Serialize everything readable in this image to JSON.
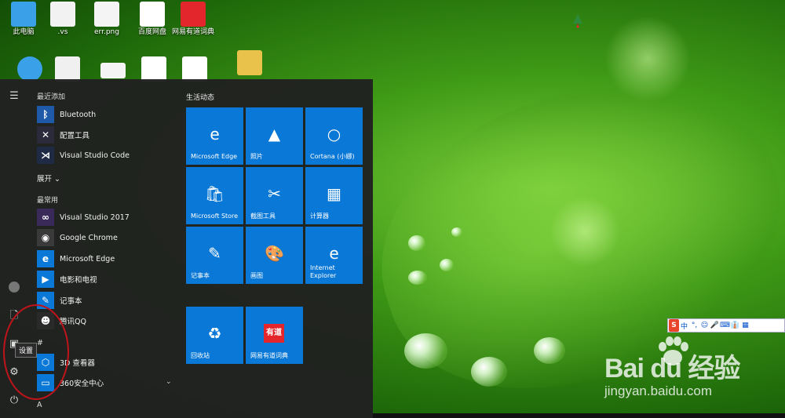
{
  "desktop": {
    "icons": [
      {
        "label": "此电脑",
        "color": "#3aa0e8"
      },
      {
        "label": ".vs",
        "color": "#f2f2f2"
      },
      {
        "label": "err.png",
        "color": "#f4f4f4"
      },
      {
        "label": "百度网盘",
        "color": "#ffffff"
      },
      {
        "label": "网易有道词典",
        "color": "#e3262b"
      }
    ],
    "tree_icon": "christmas-tree-icon"
  },
  "start_menu": {
    "recent_header": "最近添加",
    "recent": [
      {
        "label": "Bluetooth",
        "icon": "bluetooth-icon",
        "color": "#1f5aa8"
      },
      {
        "label": "配置工具",
        "icon": "tools-icon",
        "color": "#2a2a3a"
      },
      {
        "label": "Visual Studio Code",
        "icon": "vscode-icon",
        "color": "#1f2a44"
      }
    ],
    "expand_label": "展开",
    "frequent_header": "最常用",
    "frequent": [
      {
        "label": "Visual Studio 2017",
        "icon": "visual-studio-icon",
        "color": "#3a2a5a"
      },
      {
        "label": "Google Chrome",
        "icon": "chrome-icon",
        "color": "#3a3a3a"
      },
      {
        "label": "Microsoft Edge",
        "icon": "edge-icon",
        "color": "#0a78d6"
      },
      {
        "label": "电影和电视",
        "icon": "film-icon",
        "color": "#0a78d6"
      },
      {
        "label": "记事本",
        "icon": "notepad-icon",
        "color": "#0a78d6"
      },
      {
        "label": "腾讯QQ",
        "icon": "qq-icon",
        "color": "#2a2a2a"
      }
    ],
    "section_hash": "#",
    "alpha": [
      {
        "label": "3D 查看器",
        "icon": "cube-icon",
        "color": "#0a78d6"
      },
      {
        "label": "360安全中心",
        "icon": "folder-icon",
        "color": "#0a78d6"
      }
    ],
    "letter_a": "A",
    "tile_group_title": "生活动态",
    "tiles": [
      {
        "label": "Microsoft Edge",
        "icon": "edge-icon",
        "glyph": "e"
      },
      {
        "label": "照片",
        "icon": "photos-icon",
        "glyph": "▲"
      },
      {
        "label": "Cortana (小娜)",
        "icon": "cortana-icon",
        "glyph": "○"
      },
      {
        "label": "Microsoft Store",
        "icon": "store-icon",
        "glyph": "🛍"
      },
      {
        "label": "截图工具",
        "icon": "snipping-tool-icon",
        "glyph": "✂"
      },
      {
        "label": "计算器",
        "icon": "calculator-icon",
        "glyph": "▦"
      },
      {
        "label": "记事本",
        "icon": "notepad-icon",
        "glyph": "✎"
      },
      {
        "label": "画图",
        "icon": "paint-icon",
        "glyph": "🎨"
      },
      {
        "label": "Internet Explorer",
        "icon": "ie-icon",
        "glyph": "e"
      },
      {
        "label": "回收站",
        "icon": "recycle-bin-icon",
        "glyph": "♻"
      },
      {
        "label": "网易有道词典",
        "icon": "youdao-icon",
        "glyph": "有道"
      }
    ],
    "tooltip": "设置"
  },
  "ime_toolbar": {
    "logo": "S",
    "mode": "中",
    "items": [
      "°,",
      "☺",
      "🎤",
      "⌨",
      "👔",
      "▦"
    ]
  },
  "watermark": {
    "brand": "Bai du 经验",
    "url": "jingyan.baidu.com"
  }
}
